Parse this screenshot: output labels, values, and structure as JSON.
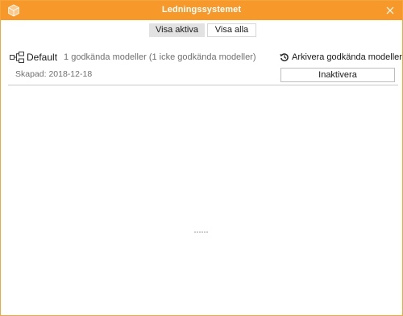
{
  "window": {
    "title": "Ledningssystemet",
    "accent_color": "#f7992a",
    "app_icon": "cube-icon",
    "close_icon": "close-icon"
  },
  "tabs": [
    {
      "label": "Visa aktiva",
      "active": true
    },
    {
      "label": "Visa alla",
      "active": false
    }
  ],
  "model": {
    "icon": "hierarchy-icon",
    "name": "Default",
    "summary": "1 godkända modeller (1 icke godkända modeller)",
    "created": "Skapad: 2018-12-18",
    "archive_icon": "history-icon",
    "archive_label": "Arkivera godkända modeller",
    "inactivate_label": "Inaktivera"
  }
}
